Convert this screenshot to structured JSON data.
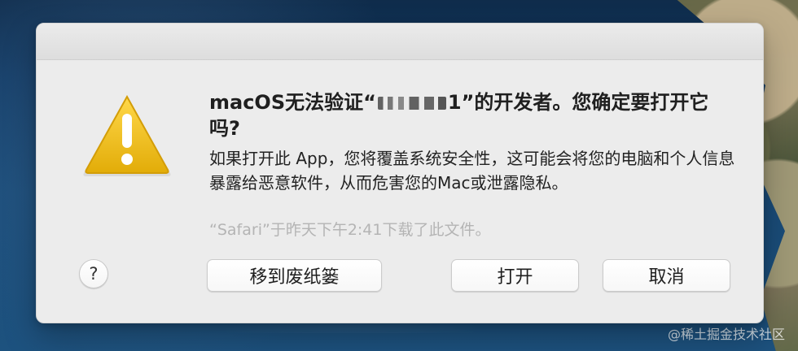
{
  "dialog": {
    "title_prefix": "macOS无法验证“",
    "title_name_suffix": "1",
    "title_suffix": "”的开发者。您确定要打开它吗?",
    "body_text": "如果打开此 App，您将覆盖系统安全性，这可能会将您的电脑和个人信息暴露给恶意软件，从而危害您的Mac或泄露隐私。",
    "download_note": "“Safari”于昨天下午2:41下载了此文件。",
    "help_label": "?",
    "buttons": {
      "trash": "移到废纸篓",
      "open": "打开",
      "cancel": "取消"
    }
  },
  "watermark": "@稀土掘金技术社区",
  "icons": {
    "warning": "warning-icon"
  },
  "colors": {
    "warning_yellow": "#f3c21b",
    "warning_orange": "#d79e06",
    "dialog_bg": "#ececec",
    "muted_text": "#b4b4b4"
  }
}
